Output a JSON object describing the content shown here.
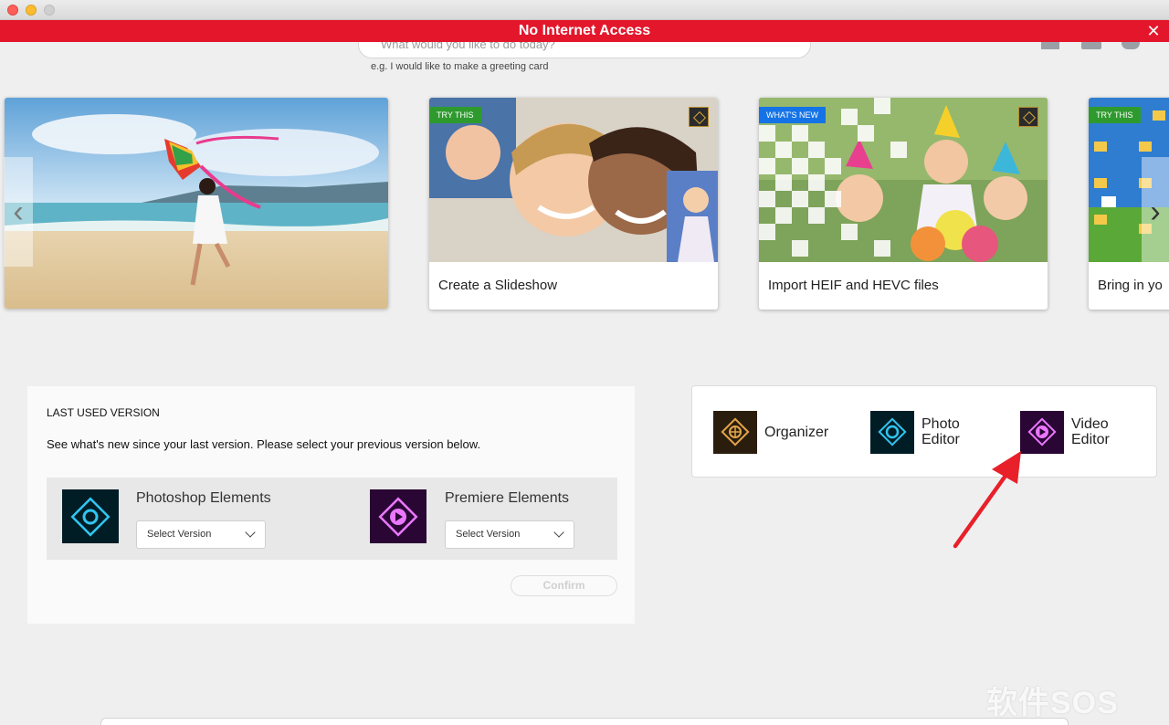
{
  "banner": {
    "text": "No Internet Access",
    "close": "✕"
  },
  "search": {
    "placeholder": "What would you like to do today?",
    "hint": "e.g. I would like to make a greeting card"
  },
  "social_icons": [
    "facebook-icon",
    "twitter-icon",
    "chat-icon"
  ],
  "carousel": {
    "prev": "‹",
    "next": "›",
    "cards": [
      {
        "label": "",
        "badge": ""
      },
      {
        "label": "Create a Slideshow",
        "badge": "TRY THIS"
      },
      {
        "label": "Import HEIF and HEVC files",
        "badge": "WHAT'S NEW"
      },
      {
        "label": "Bring in yo",
        "badge": "TRY THIS"
      }
    ]
  },
  "last_used": {
    "title": "LAST USED VERSION",
    "description": "See what's new since your last version. Please select your previous version below.",
    "products": [
      {
        "name": "Photoshop Elements",
        "select": "Select Version"
      },
      {
        "name": "Premiere Elements",
        "select": "Select Version"
      }
    ],
    "confirm": "Confirm"
  },
  "launcher": {
    "apps": [
      {
        "label": "Organizer"
      },
      {
        "label1": "Photo",
        "label2": "Editor"
      },
      {
        "label1": "Video",
        "label2": "Editor"
      }
    ]
  },
  "watermark": "软件SOS",
  "colors": {
    "banner": "#e3162b",
    "try_badge": "#2e9a2e",
    "new_badge": "#1473e6",
    "arrow": "#e8202a"
  }
}
